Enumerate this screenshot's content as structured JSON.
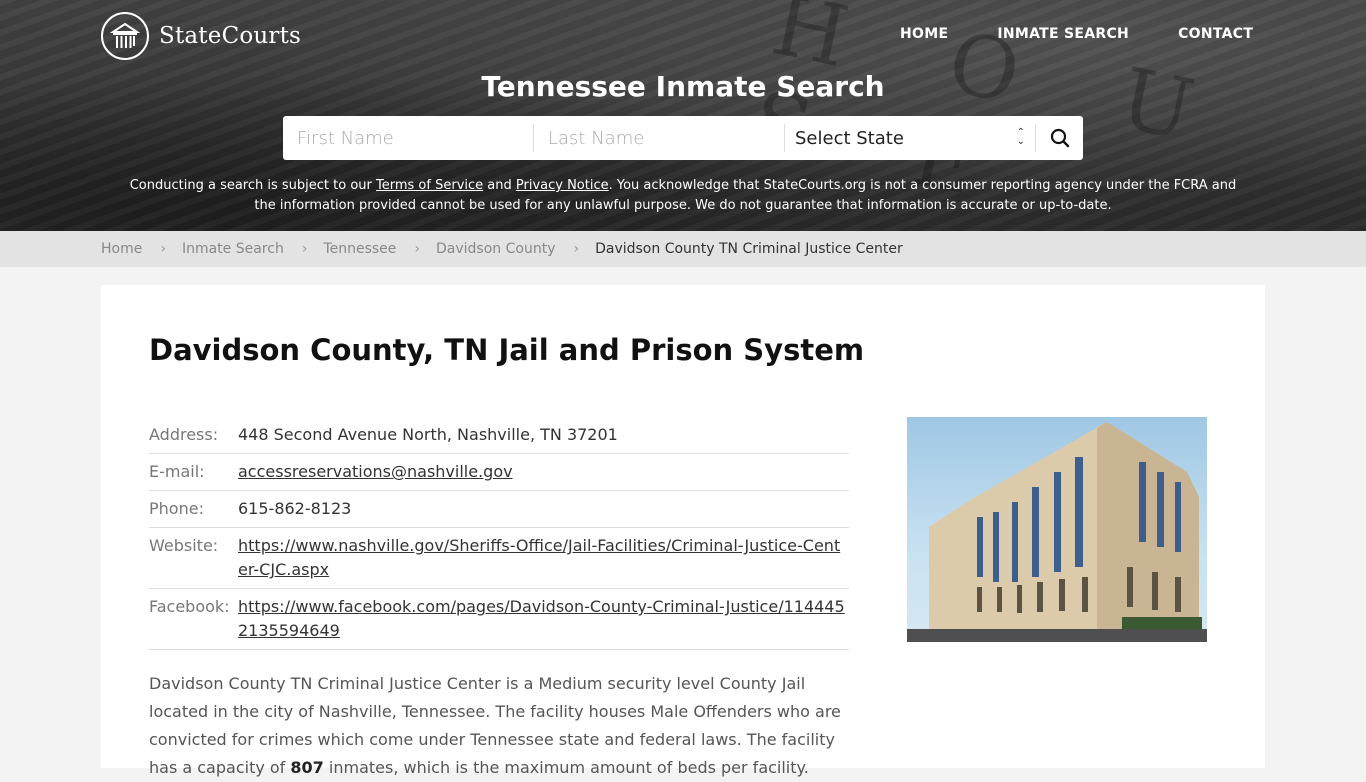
{
  "brand": {
    "name": "StateCourts",
    "logo_icon": "courthouse-columns-icon"
  },
  "nav": {
    "items": [
      {
        "label": "HOME"
      },
      {
        "label": "INMATE SEARCH"
      },
      {
        "label": "CONTACT"
      }
    ]
  },
  "hero": {
    "title": "Tennessee Inmate Search",
    "background_letters": "H O U S E"
  },
  "search": {
    "first_name_placeholder": "First Name",
    "last_name_placeholder": "Last Name",
    "first_name_value": "",
    "last_name_value": "",
    "state_selected": "Select State",
    "submit_icon": "search-icon"
  },
  "disclaimer": {
    "part1": "Conducting a search is subject to our ",
    "terms_link": "Terms of Service",
    "part2": " and ",
    "privacy_link": "Privacy Notice",
    "part3": ". You acknowledge that StateCourts.org is not a consumer reporting agency under the FCRA and the information provided cannot be used for any unlawful purpose. We do not guarantee that information is accurate or up-to-date."
  },
  "breadcrumb": {
    "items": [
      {
        "label": "Home"
      },
      {
        "label": "Inmate Search"
      },
      {
        "label": "Tennessee"
      },
      {
        "label": "Davidson County"
      }
    ],
    "current": "Davidson County TN Criminal Justice Center",
    "separator_icon": "chevron-right-icon"
  },
  "main": {
    "title": "Davidson County, TN Jail and Prison System",
    "details": {
      "address_label": "Address:",
      "address": "448 Second Avenue North, Nashville, TN 37201",
      "email_label": "E-mail:",
      "email": "accessreservations@nashville.gov",
      "phone_label": "Phone:",
      "phone": "615-862-8123",
      "website_label": "Website:",
      "website": "https://www.nashville.gov/Sheriffs-Office/Jail-Facilities/Criminal-Justice-Center-CJC.aspx",
      "facebook_label": "Facebook:",
      "facebook": "https://www.facebook.com/pages/Davidson-County-Criminal-Justice/1144452135594649"
    },
    "photo_alt": "Davidson County TN Criminal Justice Center building",
    "description": {
      "part1": "Davidson County TN Criminal Justice Center is a Medium security level County Jail located in the city of Nashville, Tennessee. The facility houses Male Offenders who are convicted for crimes which come under Tennessee state and federal laws. The facility has a capacity of ",
      "capacity": "807",
      "part2": " inmates, which is the maximum amount of beds per facility."
    }
  }
}
